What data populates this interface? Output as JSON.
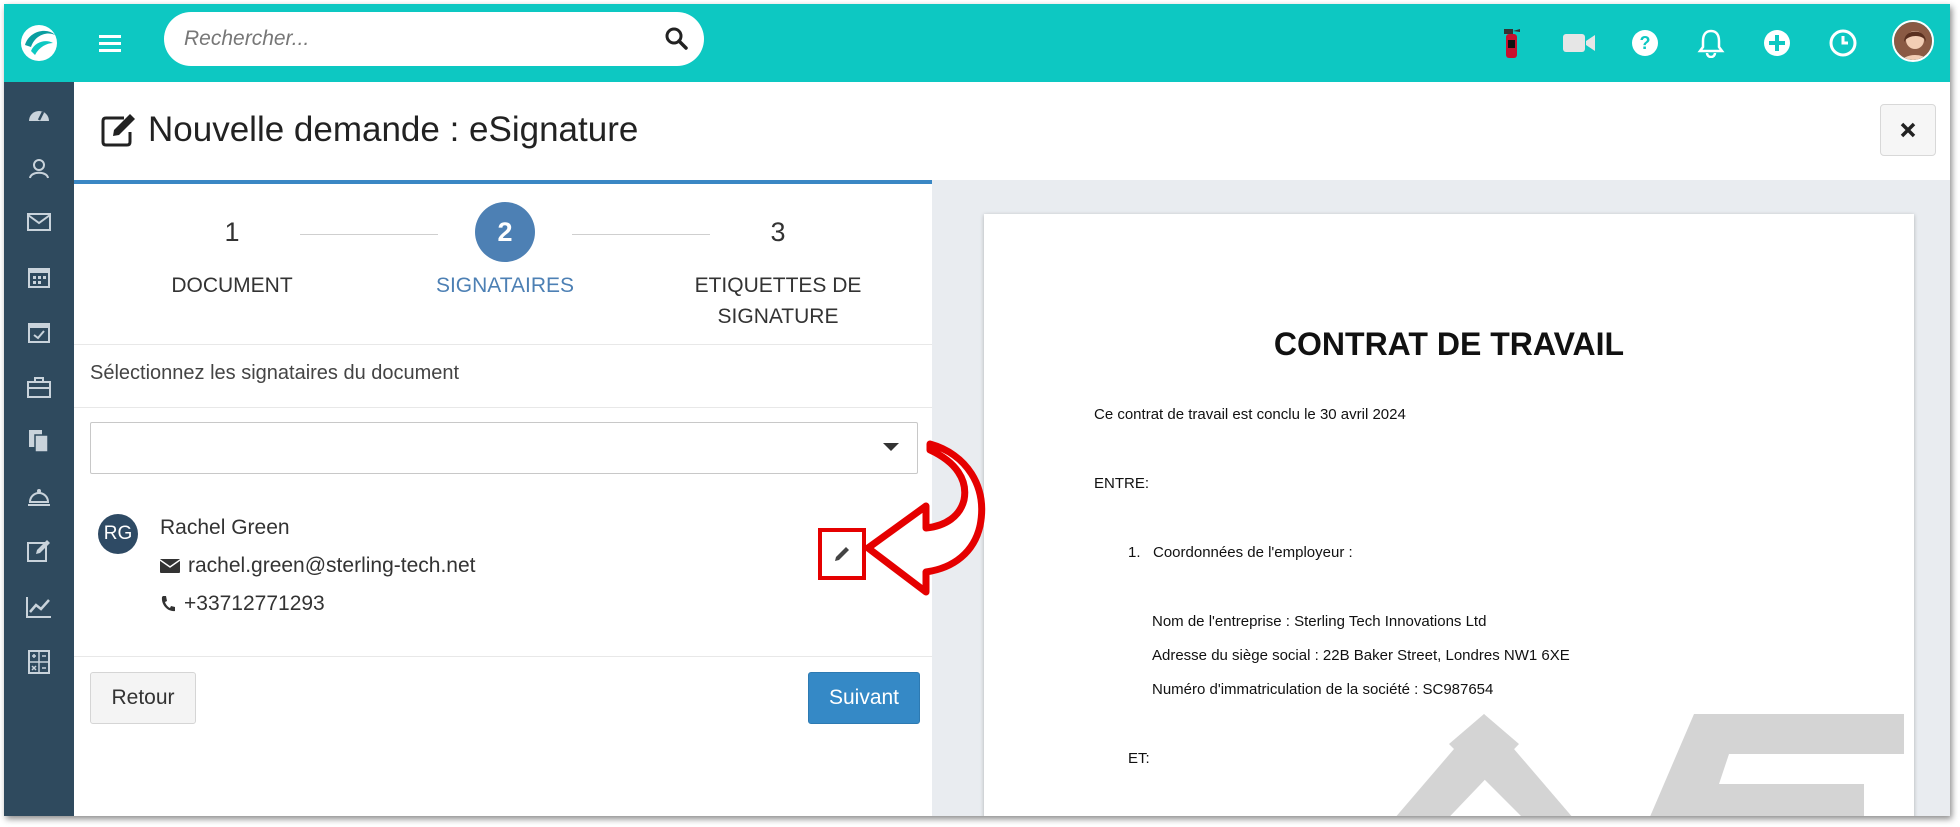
{
  "app": {
    "search_placeholder": "Rechercher...",
    "colors": {
      "topbar": "#0dc8c2",
      "sidebar": "#2f4a5e",
      "accent": "#4d80b4",
      "primary_button": "#3589c6",
      "highlight": "#e50000"
    }
  },
  "topbar": {
    "icons": [
      "logo-icon",
      "menu-icon",
      "search-icon",
      "extinguisher-icon",
      "video-icon",
      "help-icon",
      "bell-icon",
      "plus-icon",
      "clock-icon",
      "user-avatar"
    ]
  },
  "sidebar": {
    "icons": [
      "dashboard-icon",
      "contacts-icon",
      "mail-icon",
      "calendar-icon",
      "tasks-icon",
      "briefcase-icon",
      "documents-icon",
      "reception-icon",
      "edit-icon",
      "chart-icon",
      "calculator-icon"
    ]
  },
  "header": {
    "title": "Nouvelle demande : eSignature"
  },
  "wizard": {
    "steps": [
      {
        "number": "1",
        "label": "DOCUMENT"
      },
      {
        "number": "2",
        "label": "SIGNATAIRES"
      },
      {
        "number": "3",
        "label_line1": "ETIQUETTES DE",
        "label_line2": "SIGNATURE"
      }
    ],
    "active_step": 2,
    "instruction": "Sélectionnez les signataires du document",
    "select_value": ""
  },
  "signer": {
    "initials": "RG",
    "name": "Rachel Green",
    "email": "rachel.green@sterling-tech.net",
    "phone": "+33712771293"
  },
  "buttons": {
    "back": "Retour",
    "next": "Suivant"
  },
  "document": {
    "title": "CONTRAT DE TRAVAIL",
    "intro": "Ce contrat de travail est conclu le 30 avril 2024",
    "entre": "ENTRE:",
    "section1": "1.   Coordonnées de l'employeur :",
    "company": "Nom de l'entreprise : Sterling Tech Innovations Ltd",
    "address": "Adresse du siège social : 22B Baker Street, Londres NW1 6XE",
    "registration": "Numéro d'immatriculation de la société : SC987654",
    "et": "ET:"
  }
}
